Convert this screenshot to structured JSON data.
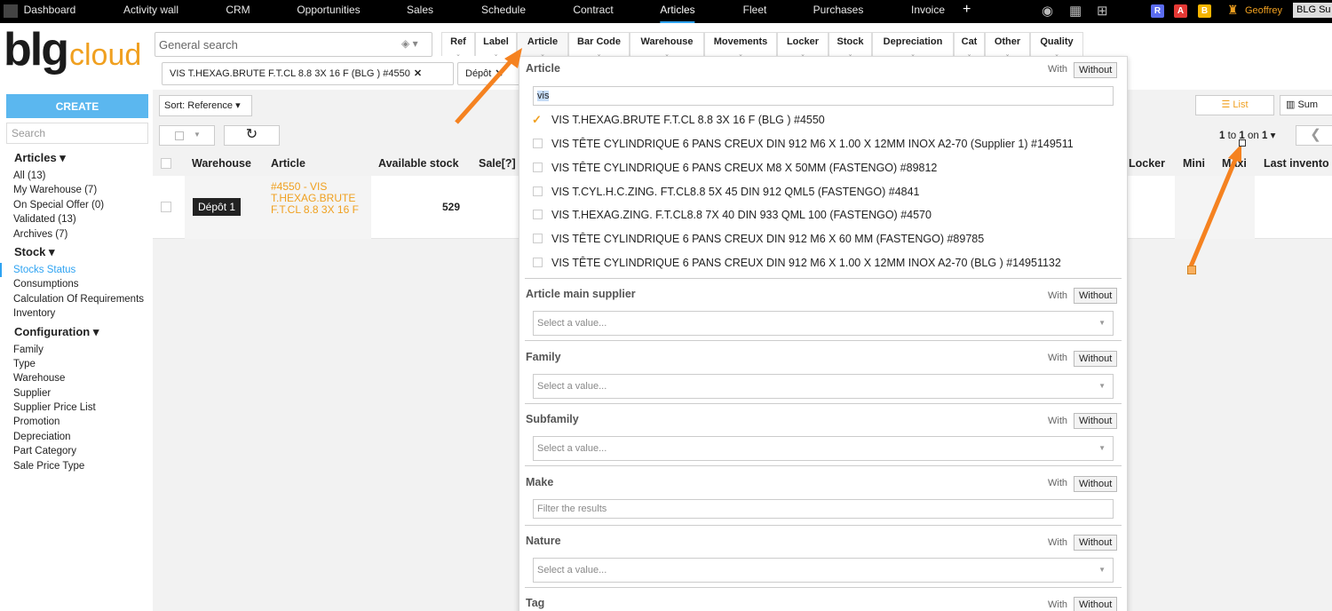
{
  "topnav": {
    "tabs": [
      "Dashboard",
      "Activity wall",
      "CRM",
      "Opportunities",
      "Sales",
      "Schedule",
      "Contract",
      "Articles",
      "Fleet",
      "Purchases",
      "Invoice"
    ],
    "active_tab": "Articles",
    "add_label": "+",
    "avatars": [
      {
        "letter": "R",
        "color": "#5b6cf0"
      },
      {
        "letter": "A",
        "color": "#e53935"
      },
      {
        "letter": "B",
        "color": "#f5b400"
      }
    ],
    "user_name": "Geoffrey",
    "company": "BLG Su"
  },
  "logo": {
    "bold": "blg",
    "light": "cloud"
  },
  "search": {
    "placeholder": "General search"
  },
  "filter_tabs": [
    "Ref",
    "Label",
    "Article",
    "Bar Code",
    "Warehouse",
    "Movements",
    "Locker",
    "Stock",
    "Depreciation",
    "Cat",
    "Other",
    "Quality"
  ],
  "active_filter_tab": "Article",
  "active_filters": [
    {
      "label": "VIS T.HEXAG.BRUTE F.T.CL 8.8 3X 16 F (BLG ) #4550",
      "remove": "✕"
    },
    {
      "label": "Dépôt",
      "remove": "✕"
    }
  ],
  "sidebar": {
    "create_label": "CREATE",
    "search_placeholder": "Search",
    "groups": [
      {
        "title": "Articles ▾",
        "items": [
          "All (13)",
          "My Warehouse (7)",
          "On Special Offer (0)",
          "Validated (13)",
          "Archives (7)"
        ]
      },
      {
        "title": "Stock ▾",
        "items": [
          "Stocks Status",
          "Consumptions",
          "Calculation Of Requirements",
          "Inventory"
        ]
      },
      {
        "title": "Configuration ▾",
        "items": [
          "Family",
          "Type",
          "Warehouse",
          "Supplier",
          "Supplier Price List",
          "Promotion",
          "Depreciation",
          "Part Category",
          "Sale Price Type"
        ]
      }
    ],
    "active_item": "Stocks Status"
  },
  "toolbar": {
    "sort_label": "Sort: Reference ▾",
    "refresh_icon": "↻",
    "list_label": "List",
    "sum_label": "Sum",
    "pager": {
      "from": "1",
      "to": "1",
      "total": "1",
      "to_word": "to",
      "on_word": "on"
    },
    "prev_icon": "❮"
  },
  "table": {
    "headers": [
      "Warehouse",
      "Article",
      "Available stock",
      "Sale",
      "Locker",
      "Mini",
      "Maxi",
      "Last invento"
    ],
    "help_marker": "[?]",
    "rows": [
      {
        "warehouse": "Dépôt 1",
        "article": "#4550 - VIS T.HEXAG.BRUTE F.T.CL 8.8 3X 16 F",
        "available_stock": "529"
      }
    ]
  },
  "filter_panel": {
    "with_label": "With",
    "without_label": "Without",
    "article": {
      "title": "Article",
      "query": "vis",
      "options": [
        {
          "label": "VIS T.HEXAG.BRUTE F.T.CL 8.8 3X 16 F (BLG ) #4550",
          "checked": true
        },
        {
          "label": "VIS TÊTE CYLINDRIQUE 6 PANS CREUX DIN 912 M6 X 1.00 X 12MM INOX A2-70 (Supplier 1) #149511",
          "checked": false
        },
        {
          "label": "VIS TÊTE CYLINDRIQUE 6 PANS CREUX M8 X 50MM (FASTENGO) #89812",
          "checked": false
        },
        {
          "label": "VIS T.CYL.H.C.ZING. FT.CL8.8 5X 45 DIN 912 QML5 (FASTENGO) #4841",
          "checked": false
        },
        {
          "label": "VIS T.HEXAG.ZING. F.T.CL8.8 7X 40 DIN 933 QML 100 (FASTENGO) #4570",
          "checked": false
        },
        {
          "label": "VIS TÊTE CYLINDRIQUE 6 PANS CREUX DIN 912 M6 X 60 MM (FASTENGO) #89785",
          "checked": false
        },
        {
          "label": "VIS TÊTE CYLINDRIQUE 6 PANS CREUX DIN 912 M6 X 1.00 X 12MM INOX A2-70 (BLG ) #14951132",
          "checked": false
        }
      ]
    },
    "sections": [
      {
        "title": "Article main supplier",
        "kind": "select",
        "placeholder": "Select a value..."
      },
      {
        "title": "Family",
        "kind": "select",
        "placeholder": "Select a value..."
      },
      {
        "title": "Subfamily",
        "kind": "select",
        "placeholder": "Select a value..."
      },
      {
        "title": "Make",
        "kind": "input",
        "placeholder": "Filter the results"
      },
      {
        "title": "Nature",
        "kind": "select",
        "placeholder": "Select a value..."
      },
      {
        "title": "Tag",
        "kind": "select",
        "placeholder": ""
      }
    ]
  },
  "colors": {
    "accent": "#f0a020",
    "link_blue": "#2ea3f2",
    "annotation_arrow": "#f58220"
  }
}
